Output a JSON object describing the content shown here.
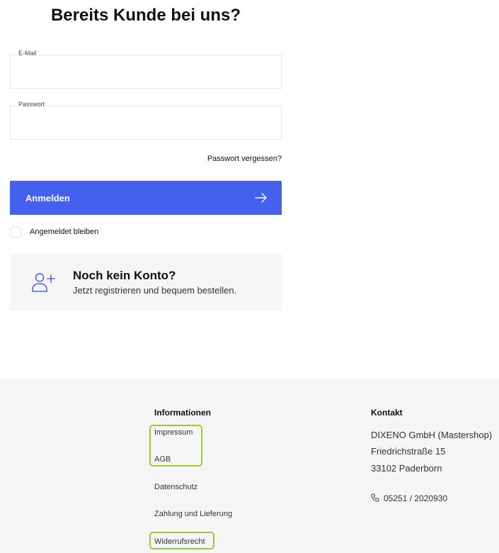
{
  "login": {
    "title": "Bereits Kunde bei uns?",
    "email_label": "E-Mail",
    "email_value": "",
    "password_label": "Passwort",
    "password_value": "",
    "forgot_password": "Passwort vergessen?",
    "submit_label": "Anmelden",
    "remember_label": "Angemeldet bleiben"
  },
  "register": {
    "title": "Noch kein Konto?",
    "subtitle": "Jetzt registrieren und bequem bestellen.",
    "icon": "user-plus-icon"
  },
  "footer": {
    "info": {
      "heading": "Informationen",
      "links": [
        "Impressum",
        "AGB",
        "Datenschutz",
        "Zahlung und Lieferung",
        "Widerrufsrecht"
      ]
    },
    "contact": {
      "heading": "Kontakt",
      "company": "DIXENO GmbH (Mastershop)",
      "street": "Friedrichstraße 15",
      "city": "33102 Paderborn",
      "phone": "05251 / 2020930",
      "phone_icon": "phone-icon"
    }
  },
  "colors": {
    "primary": "#4361ee",
    "panel": "#f5f5f5",
    "highlight": "#9acd32"
  }
}
